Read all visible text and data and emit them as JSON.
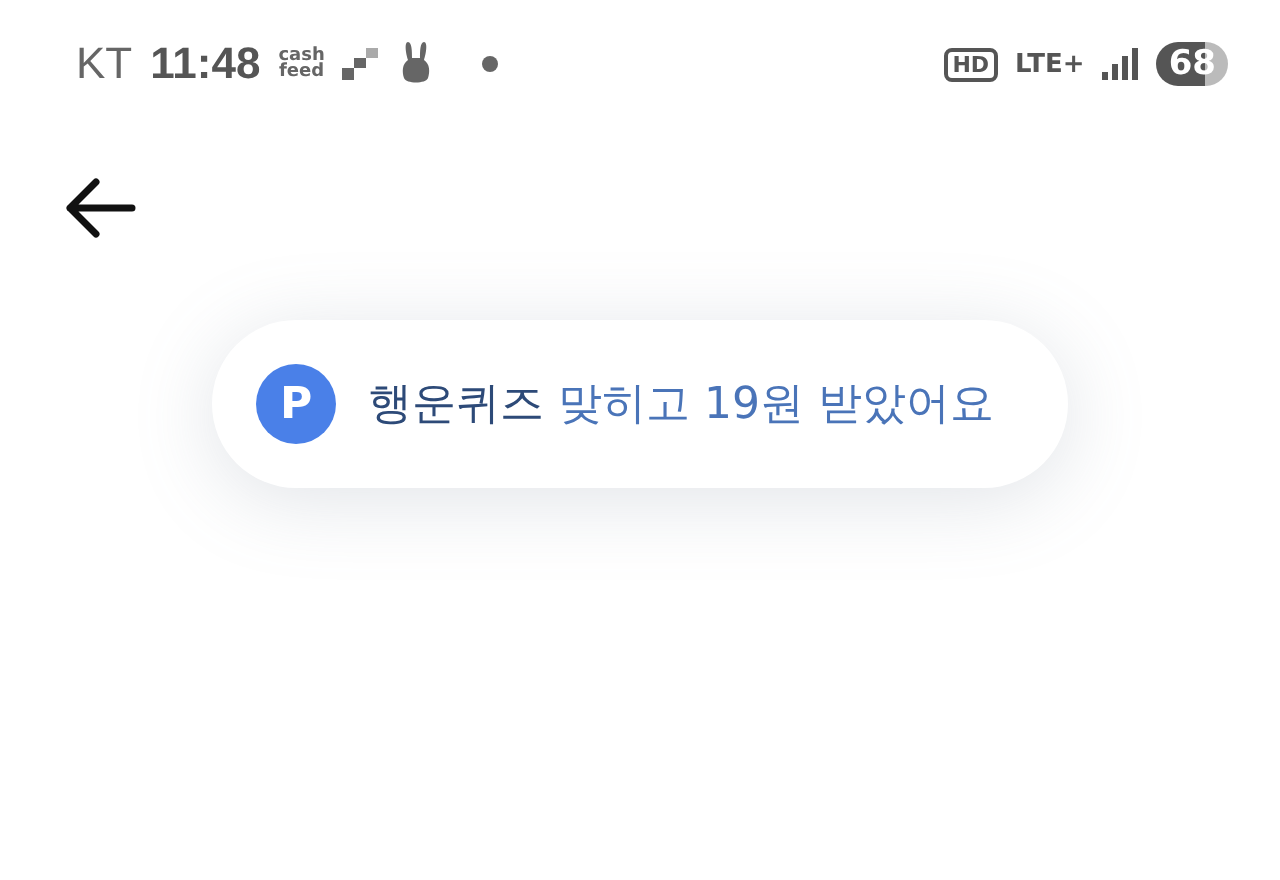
{
  "status_bar": {
    "carrier": "KT",
    "time": "11:48",
    "app_badge": [
      "cash",
      "feed"
    ],
    "hd": "HD",
    "network": "LTE+",
    "battery": "68"
  },
  "toast": {
    "icon": "P",
    "highlight": "행운퀴즈",
    "message": "맞히고 19원 받았어요"
  }
}
